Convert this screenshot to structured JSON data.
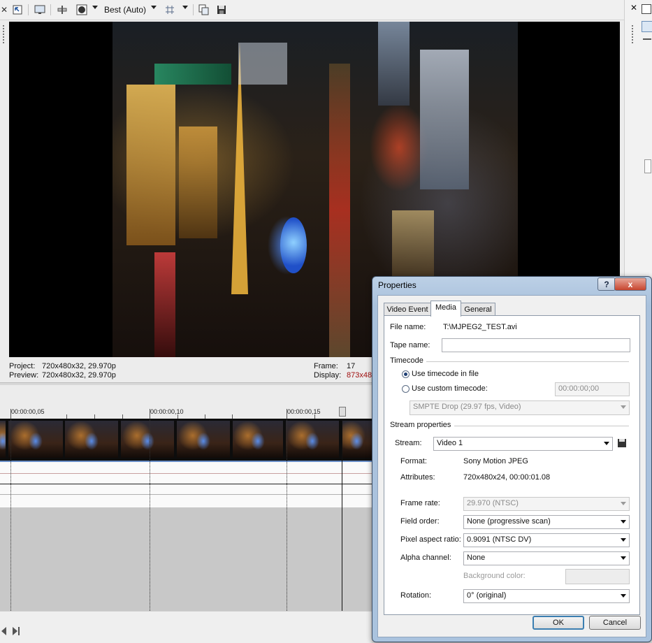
{
  "toolbar": {
    "quality_label": "Best (Auto)"
  },
  "status": {
    "project_label": "Project:",
    "project_value": "720x480x32, 29.970p",
    "preview_label": "Preview:",
    "preview_value": "720x480x32, 29.970p",
    "frame_label": "Frame:",
    "frame_value": "17",
    "display_label": "Display:",
    "display_value": "873x48"
  },
  "timeline": {
    "ruler_labels": [
      "00:00:00,05",
      "00:00:00,10",
      "00:00:00,15"
    ]
  },
  "dialog": {
    "title": "Properties",
    "help_glyph": "?",
    "close_glyph": "x",
    "tabs": [
      {
        "label": "Video Event",
        "active": false
      },
      {
        "label": "Media",
        "active": true
      },
      {
        "label": "General",
        "active": false
      }
    ],
    "media": {
      "file_name_label": "File name:",
      "file_name_value": "T:\\MJPEG2_TEST.avi",
      "tape_name_label": "Tape name:",
      "tape_name_value": "",
      "timecode_heading": "Timecode",
      "use_timecode_label": "Use timecode in file",
      "use_timecode_selected": true,
      "custom_timecode_label": "Use custom timecode:",
      "custom_timecode_value": "00:00:00;00",
      "timecode_format": "SMPTE Drop (29.97 fps, Video)",
      "stream_heading": "Stream properties",
      "stream_label": "Stream:",
      "stream_value": "Video 1",
      "format_label": "Format:",
      "format_value": "Sony Motion JPEG",
      "attributes_label": "Attributes:",
      "attributes_value": "720x480x24, 00:00:01.08",
      "frame_rate_label": "Frame rate:",
      "frame_rate_value": "29.970 (NTSC)",
      "field_order_label": "Field order:",
      "field_order_value": "None (progressive scan)",
      "pixel_aspect_label": "Pixel aspect ratio:",
      "pixel_aspect_value": "0.9091 (NTSC DV)",
      "alpha_channel_label": "Alpha channel:",
      "alpha_channel_value": "None",
      "background_color_label": "Background color:",
      "rotation_label": "Rotation:",
      "rotation_value": "0° (original)"
    },
    "ok_label": "OK",
    "cancel_label": "Cancel"
  },
  "colors": {
    "display_value": "#a01010",
    "dialog_frame": "#aac3de",
    "ok_focus": "#3c7fb1"
  }
}
